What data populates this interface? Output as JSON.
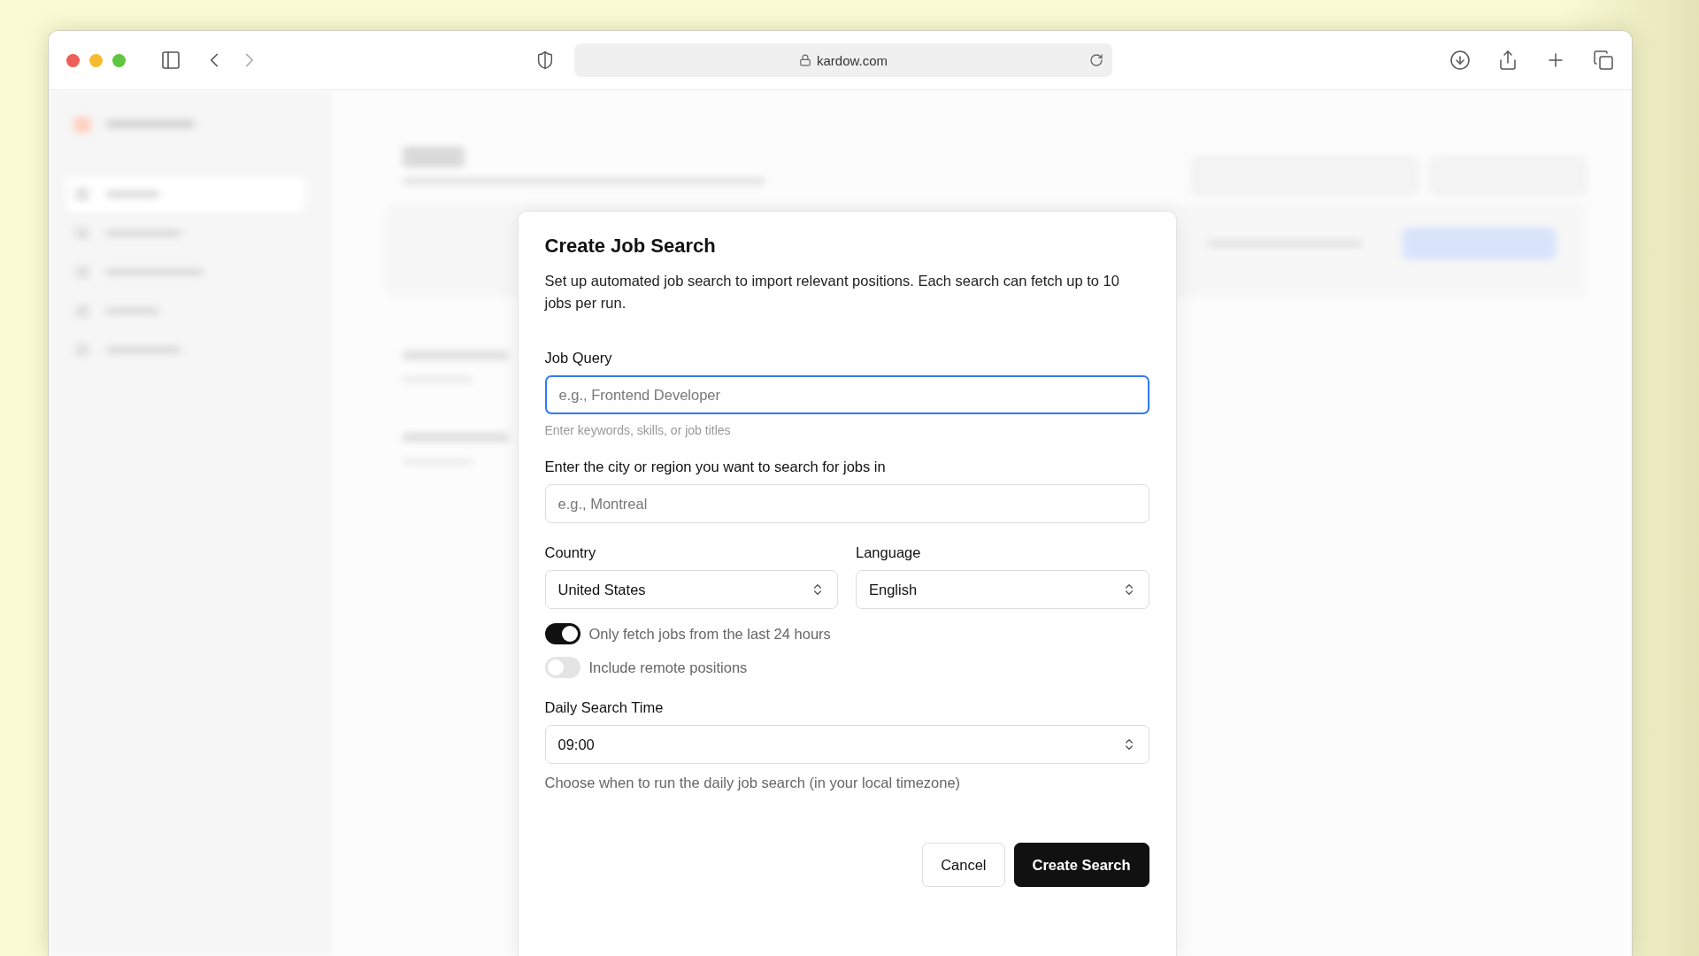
{
  "browser": {
    "url": "kardow.com"
  },
  "dialog": {
    "title": "Create Job Search",
    "description": "Set up automated job search to import relevant positions. Each search can fetch up to 10 jobs per run.",
    "fields": [
      {
        "label": "Job Query",
        "placeholder": "e.g., Frontend Developer",
        "focused": true,
        "hint": "Enter keywords, skills, or job titles"
      },
      {
        "label": "Enter the city or region you want to search for jobs in",
        "placeholder": "e.g., Montreal",
        "focused": false
      }
    ],
    "selects": [
      {
        "label": "Country",
        "value": "United States"
      },
      {
        "label": "Language",
        "value": "English"
      }
    ],
    "toggles": [
      {
        "label": "Only fetch jobs from the last 24 hours",
        "on": true
      },
      {
        "label": "Include remote positions",
        "on": false
      }
    ],
    "time": {
      "label": "Daily Search Time",
      "value": "09:00",
      "hint": "Choose when to run the daily job search (in your local timezone)"
    },
    "buttons": [
      {
        "label": "Cancel",
        "kind": "secondary"
      },
      {
        "label": "Create Search",
        "kind": "primary"
      }
    ]
  }
}
